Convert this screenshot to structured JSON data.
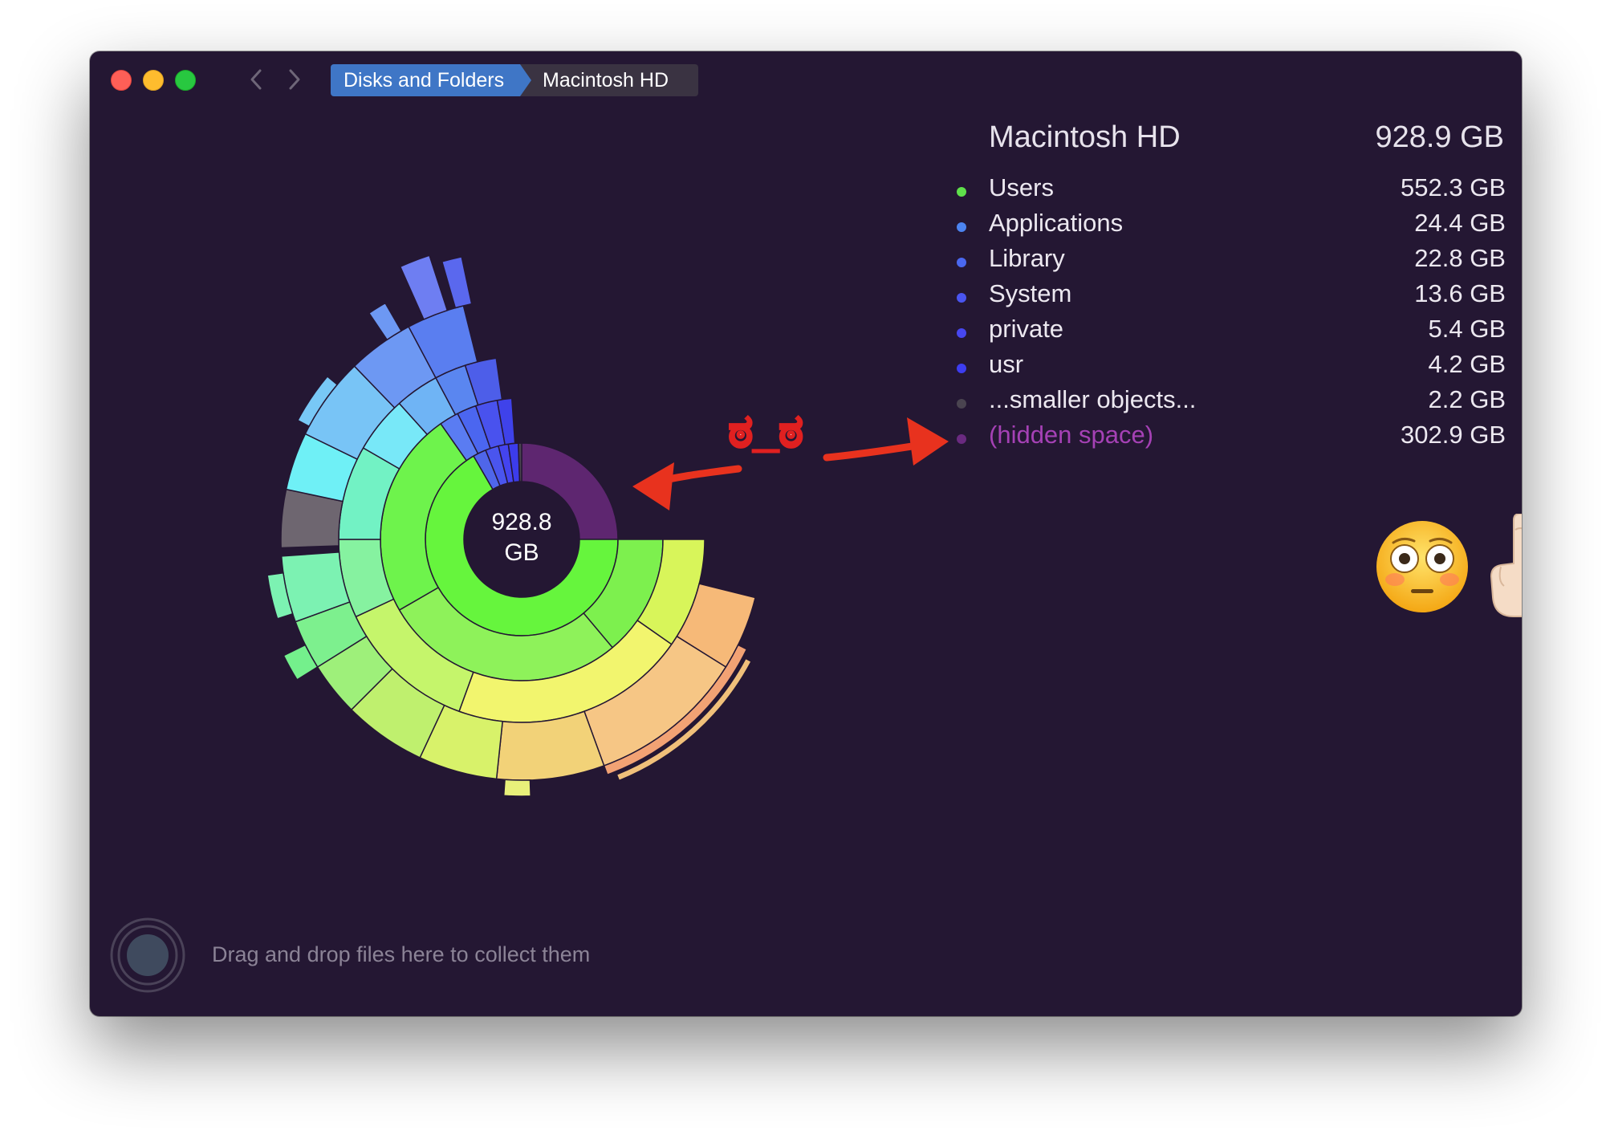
{
  "breadcrumb": {
    "items": [
      "Disks and Folders",
      "Macintosh HD"
    ]
  },
  "legend": {
    "title": "Macintosh HD",
    "total": "928.9 GB",
    "items": [
      {
        "label": "Users",
        "size": "552.3 GB",
        "color": "#5fe04b"
      },
      {
        "label": "Applications",
        "size": "24.4 GB",
        "color": "#4c84f0"
      },
      {
        "label": "Library",
        "size": "22.8 GB",
        "color": "#4a68f0"
      },
      {
        "label": "System",
        "size": "13.6 GB",
        "color": "#4a55f0"
      },
      {
        "label": "private",
        "size": "5.4 GB",
        "color": "#4747f0"
      },
      {
        "label": "usr",
        "size": "4.2 GB",
        "color": "#3d3df0"
      },
      {
        "label": "...smaller objects...",
        "size": "2.2 GB",
        "color": "#4a4450"
      },
      {
        "label": "(hidden space)",
        "size": "302.9 GB",
        "color": "#6a2a80"
      }
    ]
  },
  "center": {
    "line1": "928.8",
    "line2": "GB"
  },
  "drop_zone": {
    "text": "Drag and drop files here to collect them"
  },
  "annotation": {
    "text": "ಠ_ಠ"
  },
  "colors": {
    "window_bg": "#241733",
    "hidden_space": "#5e2670",
    "arrow": "#e8321e"
  }
}
